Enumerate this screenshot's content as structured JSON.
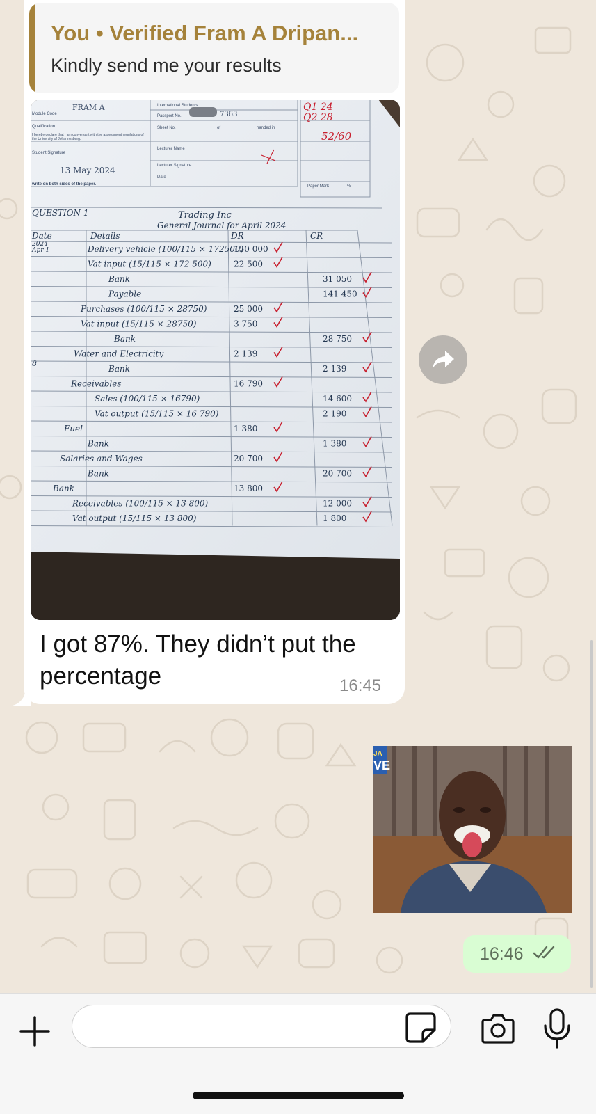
{
  "quoted_reply": {
    "author": "You • Verified Fram A Dripan...",
    "text": "Kindly send me your results"
  },
  "incoming_message": {
    "text": "I got 87%. They didn’t put the percentage",
    "time": "16:45"
  },
  "photo": {
    "header": {
      "name": "FRAM A",
      "date": "13 May 2024",
      "international_students": "International Students",
      "passport_label": "Passport No.",
      "passport_visible": "7363",
      "sheet_label": "Sheet No.",
      "of_label": "of",
      "handed_in": "handed in",
      "lecturer_name": "Lecturer Name",
      "lecturer_signature": "Lecturer Signature",
      "date_label": "Date",
      "paper_mark": "Paper Mark",
      "percent_sign": "%",
      "module_label": "Module Code",
      "qualification_label": "Qualification",
      "declaration": "I hereby declare that I am conversant with the assessment regulations of the University of Johannesburg.",
      "student_label": "Student Signature",
      "note": "write on both sides of the paper."
    },
    "scores": {
      "q1": "Q1 24",
      "q2": "Q2 28",
      "total": "52/60"
    },
    "journal": {
      "question": "QUESTION 1",
      "title": "Trading Inc",
      "subtitle": "General Journal for April 2024",
      "col_date": "Date",
      "col_details": "Details",
      "col_dr": "DR",
      "col_cr": "CR",
      "date_year": "2024",
      "date_month": "Apr 1",
      "date_8": "8",
      "rows": [
        {
          "details": "Delivery vehicle (100/115 × 172500)",
          "dr": "150 000",
          "cr": ""
        },
        {
          "details": "Vat input (15/115 × 172 500)",
          "dr": "22 500",
          "cr": ""
        },
        {
          "details": "Bank",
          "dr": "",
          "cr": "31 050"
        },
        {
          "details": "Payable",
          "dr": "",
          "cr": "141 450"
        },
        {
          "details": "Purchases (100/115 × 28750)",
          "dr": "25 000",
          "cr": ""
        },
        {
          "details": "Vat input (15/115 × 28750)",
          "dr": "3 750",
          "cr": ""
        },
        {
          "details": "Bank",
          "dr": "",
          "cr": "28 750"
        },
        {
          "details": "Water and Electricity",
          "dr": "2 139",
          "cr": ""
        },
        {
          "details": "Bank",
          "dr": "",
          "cr": "2 139"
        },
        {
          "details": "Receivables",
          "dr": "16 790",
          "cr": ""
        },
        {
          "details": "Sales (100/115 × 16790)",
          "dr": "",
          "cr": "14 600"
        },
        {
          "details": "Vat output (15/115 × 16 790)",
          "dr": "",
          "cr": "2 190"
        },
        {
          "details": "Fuel",
          "dr": "1 380",
          "cr": ""
        },
        {
          "details": "Bank",
          "dr": "",
          "cr": "1 380"
        },
        {
          "details": "Salaries and Wages",
          "dr": "20 700",
          "cr": ""
        },
        {
          "details": "Bank",
          "dr": "",
          "cr": "20 700"
        },
        {
          "details": "Bank",
          "dr": "13 800",
          "cr": ""
        },
        {
          "details": "Receivables (100/115 × 13 800)",
          "dr": "",
          "cr": "12 000"
        },
        {
          "details": "Vat output (15/115 × 13 800)",
          "dr": "",
          "cr": "1 800"
        }
      ]
    }
  },
  "sticker": {
    "channel_badge": "JA\nVE"
  },
  "outgoing_message": {
    "time": "16:46",
    "status": "read"
  },
  "composer": {
    "placeholder": ""
  },
  "icons": {
    "forward": "forward-icon",
    "plus": "plus-icon",
    "sticker": "sticker-icon",
    "camera": "camera-icon",
    "mic": "microphone-icon",
    "ticks": "double-check-icon"
  },
  "colors": {
    "background": "#efe7dc",
    "quote_accent": "#a5823a",
    "outgoing_bubble": "#d9fdd3",
    "read_ticks": "#5e6e5a",
    "marking_red": "#c8202f"
  }
}
